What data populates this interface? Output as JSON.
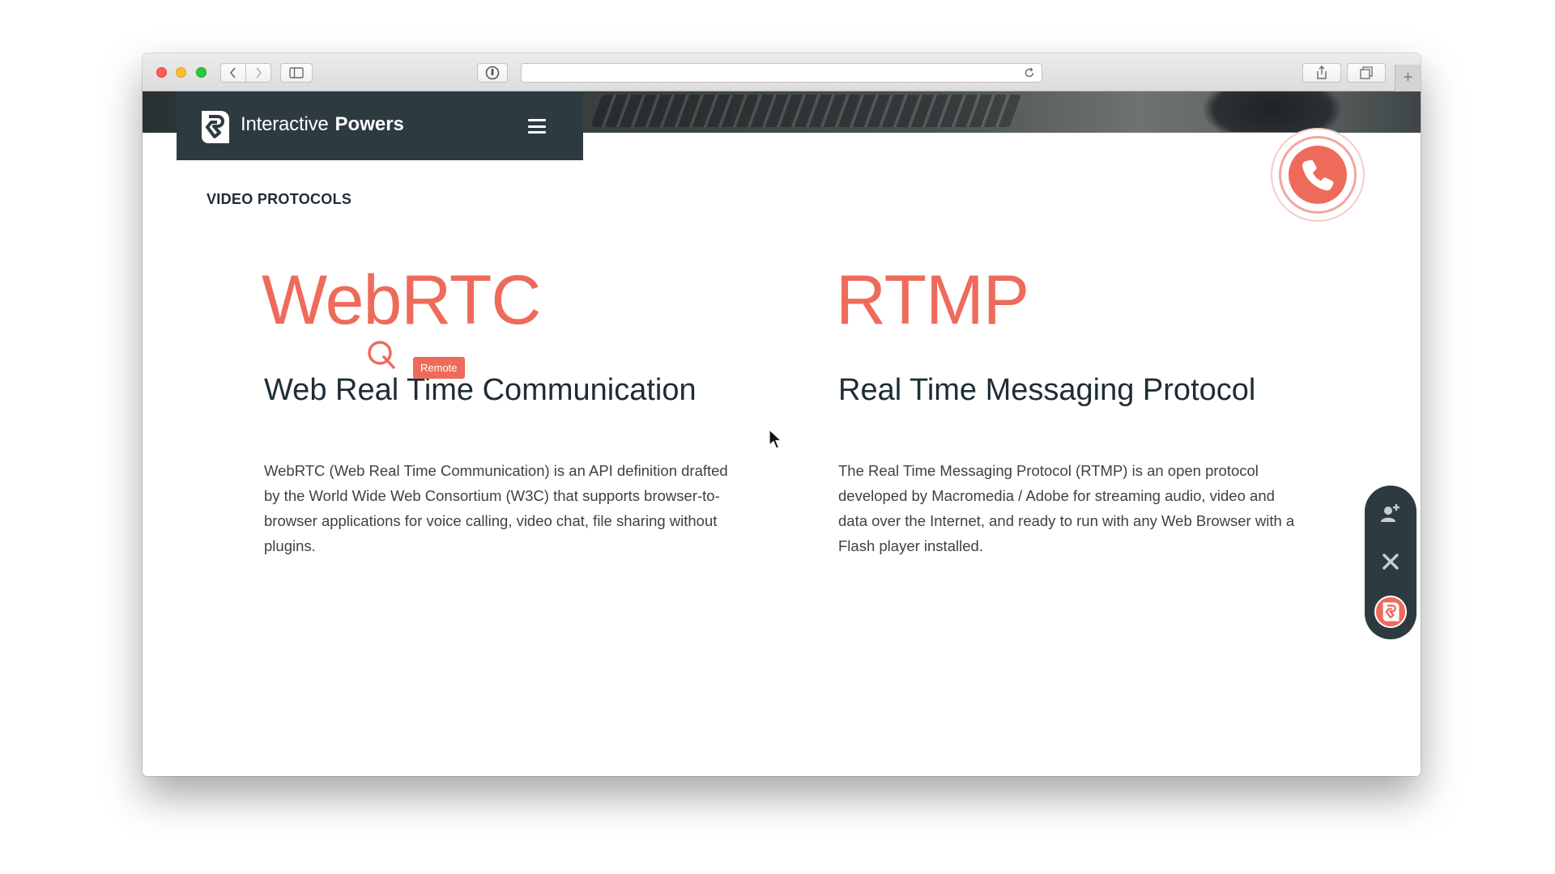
{
  "browser": {
    "address": "",
    "new_tab_symbol": "+"
  },
  "brand": {
    "name_light": "Interactive",
    "name_bold": "Powers"
  },
  "section": {
    "title": "VIDEO PROTOCOLS"
  },
  "protocols": [
    {
      "name": "WebRTC",
      "subtitle": "Web Real Time Communication",
      "description": "WebRTC (Web Real Time Communication) is an API definition drafted by the World Wide Web Consortium (W3C) that supports browser-to-browser applications for voice calling, video chat, file sharing without plugins."
    },
    {
      "name": "RTMP",
      "subtitle": "Real Time Messaging Protocol",
      "description": "The Real Time Messaging Protocol (RTMP) is an open protocol developed by Macromedia / Adobe for streaming audio, video and data over the Internet, and ready to run with any Web Browser with a Flash player installed."
    }
  ],
  "remote_pointer": {
    "label": "Remote"
  },
  "icons": {
    "call": "phone-icon",
    "add_contact": "add-user-icon",
    "close": "close-icon",
    "logo": "interactive-powers-logo-icon",
    "menu": "hamburger-menu-icon"
  },
  "colors": {
    "accent": "#ee6b5b",
    "navy": "#2d3b41",
    "heading": "#1e2d35",
    "body_text": "#3b4246"
  }
}
